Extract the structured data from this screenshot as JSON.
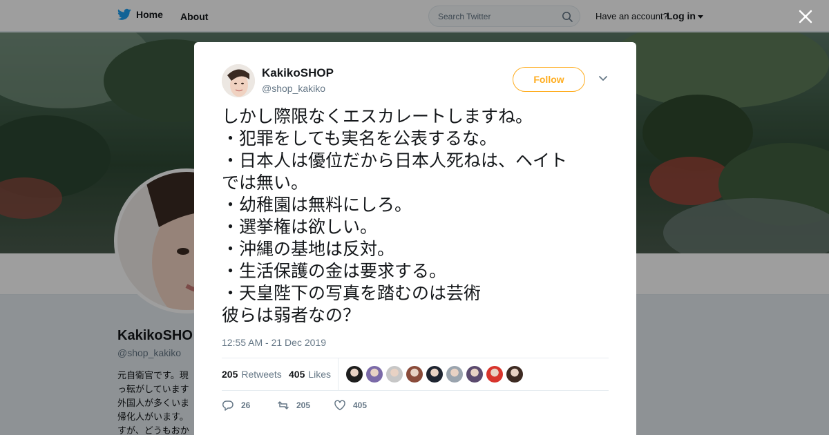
{
  "topbar": {
    "home_label": "Home",
    "about_label": "About",
    "search_placeholder": "Search Twitter",
    "have_account": "Have an account?",
    "login_label": "Log in"
  },
  "profile": {
    "name": "KakikoSHO",
    "handle": "@shop_kakiko",
    "bio_lines": [
      "元自衛官です。現",
      "っ転がしています",
      "外国人が多くいま",
      "帰化人がいます。",
      "すが、どうもおか"
    ]
  },
  "tweet": {
    "author_name": "KakikoSHOP",
    "author_handle": "@shop_kakiko",
    "follow_label": "Follow",
    "text_lines": [
      "しかし際限なくエスカレートしますね。",
      "・犯罪をしても実名を公表するな。",
      "・日本人は優位だから日本人死ねは、ヘイト",
      "では無い。",
      "・幼稚園は無料にしろ。",
      "・選挙権は欲しい。",
      "・沖縄の基地は反対。",
      "・生活保護の金は要求する。",
      "・天皇陛下の写真を踏むのは芸術",
      "彼らは弱者なの？"
    ],
    "timestamp": "12:55 AM - 21 Dec 2019",
    "retweets_count": "205",
    "retweets_label": "Retweets",
    "likes_count": "405",
    "likes_label": "Likes",
    "reply_count": "26",
    "retweet_action_count": "205",
    "like_action_count": "405",
    "liker_colors": [
      "#1d1d1d",
      "#7b6aa8",
      "#c7c7c7",
      "#8a4b3a",
      "#1e2430",
      "#9aa4ae",
      "#5b4a6e",
      "#d8342c",
      "#3d2a22"
    ]
  },
  "colors": {
    "accent": "#ffad1f",
    "twitter_blue": "#1da1f2",
    "muted": "#657786"
  }
}
